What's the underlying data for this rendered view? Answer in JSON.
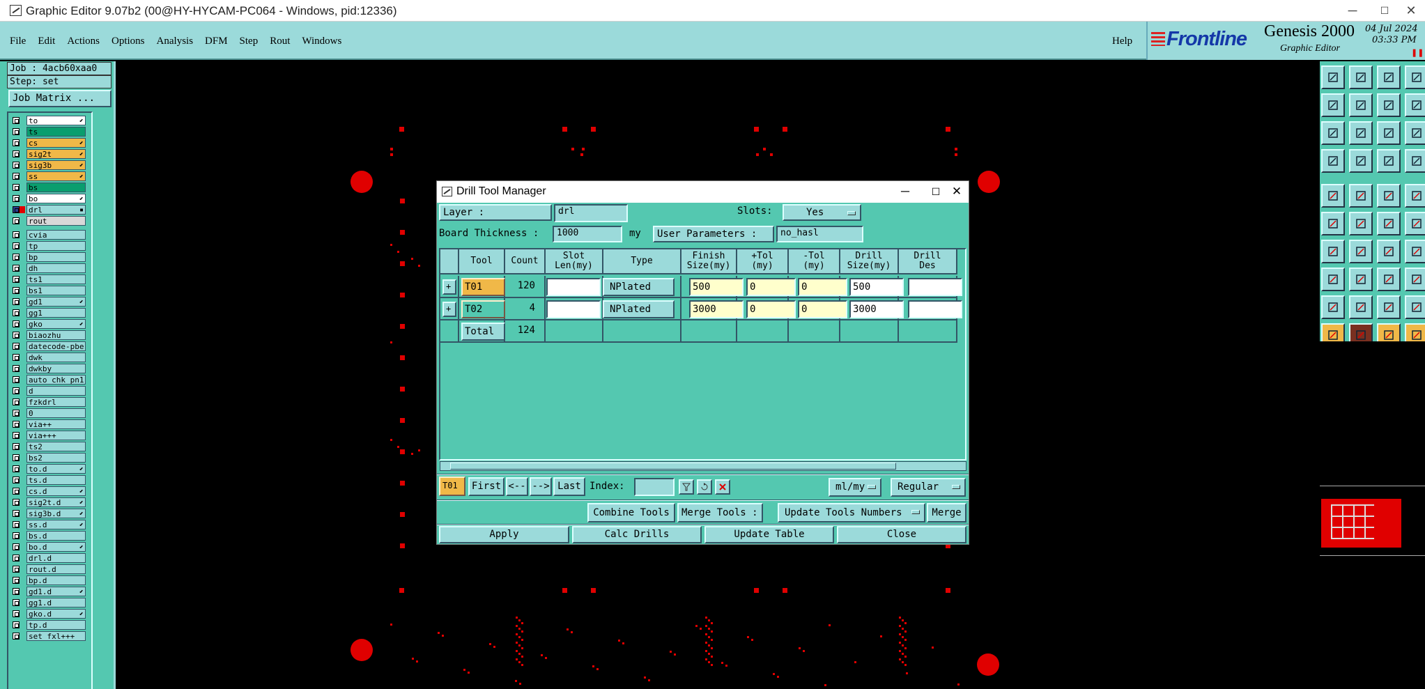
{
  "window": {
    "title": "Graphic Editor 9.07b2 (00@HY-HYCAM-PC064 - Windows, pid:12336)",
    "min": "─",
    "max": "☐",
    "close": "✕"
  },
  "menu": {
    "items": [
      "File",
      "Edit",
      "Actions",
      "Options",
      "Analysis",
      "DFM",
      "Step",
      "Rout",
      "Windows"
    ],
    "help": "Help"
  },
  "brand": {
    "logo": "Frontline",
    "product": "Genesis 2000",
    "subtitle": "Graphic Editor",
    "date": "04 Jul 2024",
    "time": "03:33 PM",
    "pause": "❚❚"
  },
  "job": {
    "job_label": "Job : 4acb60xaa0",
    "step_label": "Step: set",
    "matrix_button": "Job Matrix ..."
  },
  "layers": [
    {
      "name": "to",
      "color": "#ffffff",
      "mark": "⬋"
    },
    {
      "name": "ts",
      "color": "#0a9e6e",
      "mark": ""
    },
    {
      "name": "cs",
      "color": "#f0b848",
      "mark": "⬋"
    },
    {
      "name": "sig2t",
      "color": "#f0b848",
      "mark": "⬋"
    },
    {
      "name": "sig3b",
      "color": "#f0b848",
      "mark": "⬋"
    },
    {
      "name": "ss",
      "color": "#f0b848",
      "mark": "⬋"
    },
    {
      "name": "bs",
      "color": "#0a9e6e",
      "mark": ""
    },
    {
      "name": "bo",
      "color": "#ffffff",
      "mark": "⬋"
    },
    {
      "name": "drl",
      "color": "#9bdada",
      "mark": "▪"
    },
    {
      "name": "rout",
      "color": "#d8d8d8",
      "mark": ""
    },
    {
      "name": "cvia",
      "color": "#9bdada",
      "mark": ""
    },
    {
      "name": "tp",
      "color": "#9bdada",
      "mark": ""
    },
    {
      "name": "bp",
      "color": "#9bdada",
      "mark": ""
    },
    {
      "name": "dh",
      "color": "#9bdada",
      "mark": ""
    },
    {
      "name": "ts1",
      "color": "#9bdada",
      "mark": ""
    },
    {
      "name": "bs1",
      "color": "#9bdada",
      "mark": ""
    },
    {
      "name": "gd1",
      "color": "#9bdada",
      "mark": "⬋"
    },
    {
      "name": "gg1",
      "color": "#9bdada",
      "mark": ""
    },
    {
      "name": "gko",
      "color": "#9bdada",
      "mark": "⬋"
    },
    {
      "name": "biaozhu",
      "color": "#9bdada",
      "mark": ""
    },
    {
      "name": "datecode-pbe",
      "color": "#9bdada",
      "mark": ""
    },
    {
      "name": "dwk",
      "color": "#9bdada",
      "mark": ""
    },
    {
      "name": "dwkby",
      "color": "#9bdada",
      "mark": ""
    },
    {
      "name": "auto_chk_pn1",
      "color": "#9bdada",
      "mark": ""
    },
    {
      "name": "d",
      "color": "#9bdada",
      "mark": ""
    },
    {
      "name": "fzkdrl",
      "color": "#9bdada",
      "mark": ""
    },
    {
      "name": "0",
      "color": "#9bdada",
      "mark": ""
    },
    {
      "name": "via++",
      "color": "#9bdada",
      "mark": ""
    },
    {
      "name": "via+++",
      "color": "#9bdada",
      "mark": ""
    },
    {
      "name": "ts2",
      "color": "#9bdada",
      "mark": ""
    },
    {
      "name": "bs2",
      "color": "#9bdada",
      "mark": ""
    },
    {
      "name": "to.d",
      "color": "#9bdada",
      "mark": "⬋"
    },
    {
      "name": "ts.d",
      "color": "#9bdada",
      "mark": ""
    },
    {
      "name": "cs.d",
      "color": "#9bdada",
      "mark": "⬋"
    },
    {
      "name": "sig2t.d",
      "color": "#9bdada",
      "mark": "⬋"
    },
    {
      "name": "sig3b.d",
      "color": "#9bdada",
      "mark": "⬋"
    },
    {
      "name": "ss.d",
      "color": "#9bdada",
      "mark": "⬋"
    },
    {
      "name": "bs.d",
      "color": "#9bdada",
      "mark": ""
    },
    {
      "name": "bo.d",
      "color": "#9bdada",
      "mark": "⬋"
    },
    {
      "name": "drl.d",
      "color": "#9bdada",
      "mark": ""
    },
    {
      "name": "rout.d",
      "color": "#9bdada",
      "mark": ""
    },
    {
      "name": "bp.d",
      "color": "#9bdada",
      "mark": ""
    },
    {
      "name": "gd1.d",
      "color": "#9bdada",
      "mark": "⬋"
    },
    {
      "name": "gg1.d",
      "color": "#9bdada",
      "mark": ""
    },
    {
      "name": "gko.d",
      "color": "#9bdada",
      "mark": "⬋"
    },
    {
      "name": "tp.d",
      "color": "#9bdada",
      "mark": ""
    },
    {
      "name": "set_fxl+++",
      "color": "#9bdada",
      "mark": ""
    }
  ],
  "dialog": {
    "title": "Drill Tool Manager",
    "layer_label": "Layer            :",
    "layer_value": "drl",
    "slots_label": "Slots:",
    "slots_value": "Yes",
    "thickness_label": "Board Thickness :",
    "thickness_value": "1000",
    "thickness_unit": "my",
    "user_params_label": "User Parameters :",
    "user_params_value": "no_hasl",
    "columns": [
      "Tool",
      "Count",
      "Slot\nLen(my)",
      "Type",
      "Finish\nSize(my)",
      "+Tol\n(my)",
      "-Tol\n(my)",
      "Drill\nSize(my)",
      "Drill\nDes"
    ],
    "rows": [
      {
        "tool": "T01",
        "count": "120",
        "slot_len": "",
        "type": "NPlated",
        "finish": "500",
        "ptol": "0",
        "mtol": "0",
        "drill": "500",
        "des": ""
      },
      {
        "tool": "T02",
        "count": "4",
        "slot_len": "",
        "type": "NPlated",
        "finish": "3000",
        "ptol": "0",
        "mtol": "0",
        "drill": "3000",
        "des": ""
      }
    ],
    "total_label": "Total",
    "total_count": "124",
    "nav": {
      "current": "T01",
      "first": "First",
      "prev": "<--",
      "next": "-->",
      "last": "Last",
      "index_label": "Index:",
      "units": "ml/my",
      "mode": "Regular"
    },
    "combine": "Combine Tools",
    "merge_label": "Merge Tools :",
    "merge_option": "Update Tools Numbers",
    "merge_button": "Merge",
    "apply": "Apply",
    "calc": "Calc Drills",
    "update": "Update Table",
    "close": "Close"
  },
  "colors": {
    "pad": "#e00000",
    "panel": "#54c8b0",
    "accent": "#9bdada",
    "tool_yellow": "#f0b848"
  }
}
